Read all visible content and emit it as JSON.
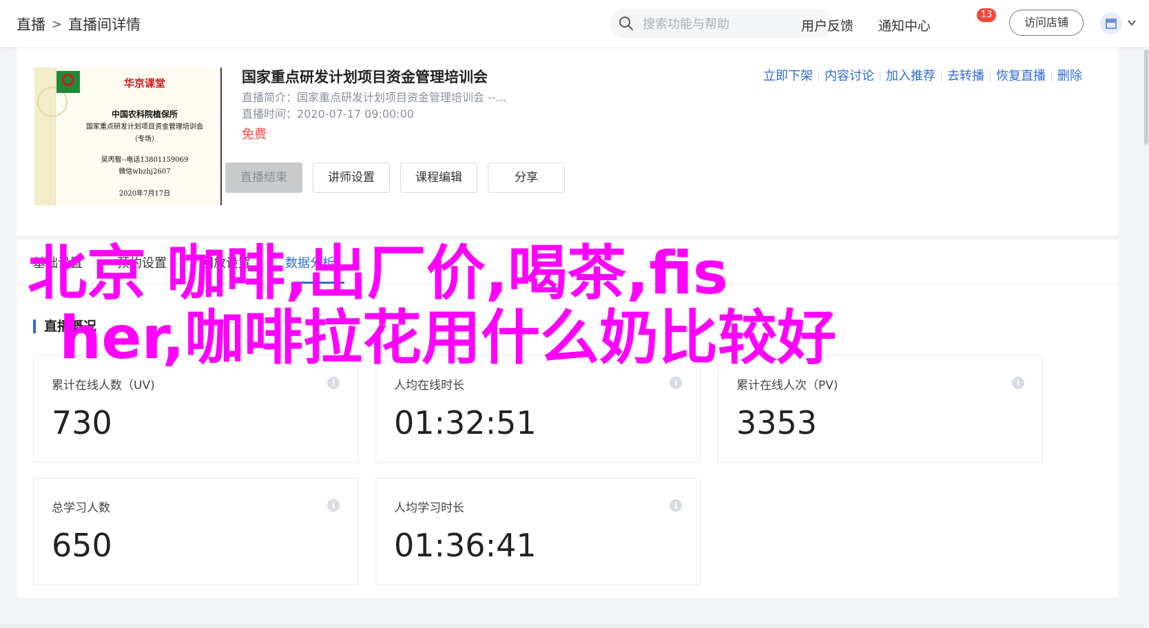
{
  "header": {
    "breadcrumb": [
      "直播",
      "直播间详情"
    ],
    "breadcrumb_sep": ">",
    "search_placeholder": "搜索功能与帮助",
    "feedback": "用户反馈",
    "notification": "通知中心",
    "notification_count": "13",
    "visit_store": "访问店铺"
  },
  "live": {
    "title": "国家重点研发计划项目资金管理培训会",
    "intro_label": "直播简介：",
    "intro_value": "国家重点研发计划项目资金管理培训会 --...",
    "time_label": "直播时间：",
    "time_value": "2020-07-17 09:00:00",
    "price": "免费",
    "poster": {
      "brand": "华京课堂",
      "org": "中国农科院植保所",
      "course": "国家重点研发计划项目资金管理培训会",
      "tag": "（专场）",
      "contact": "吴丙智--电话13801159069",
      "wechat": "微信wbzhj2607",
      "date": "2020年7月17日"
    },
    "ops": [
      "立即下架",
      "内容讨论",
      "加入推荐",
      "去转播",
      "恢复直播",
      "删除"
    ],
    "buttons": {
      "end": "直播结束",
      "teacher": "讲师设置",
      "edit": "课程编辑",
      "share": "分享"
    }
  },
  "tabs": [
    "基础设置",
    "预约设置",
    "回放设置",
    "数据分析"
  ],
  "overview": {
    "title": "直播概况",
    "stats": [
      {
        "label": "累计在线人数（UV)",
        "value": "730"
      },
      {
        "label": "人均在线时长",
        "value": "01:32:51"
      },
      {
        "label": "累计在线人次（PV)",
        "value": "3353"
      },
      {
        "label": "总学习人数",
        "value": "650"
      },
      {
        "label": "人均学习时长",
        "value": "01:36:41"
      }
    ]
  },
  "watermark": {
    "line1": "北京 咖啡,出厂价,喝茶,fis",
    "line2": "her,咖啡拉花用什么奶比较好"
  },
  "colors": {
    "accent": "#2f6cd8",
    "price": "#f34a3a",
    "badge": "#f5483b",
    "watermark": "#ff00ff"
  }
}
